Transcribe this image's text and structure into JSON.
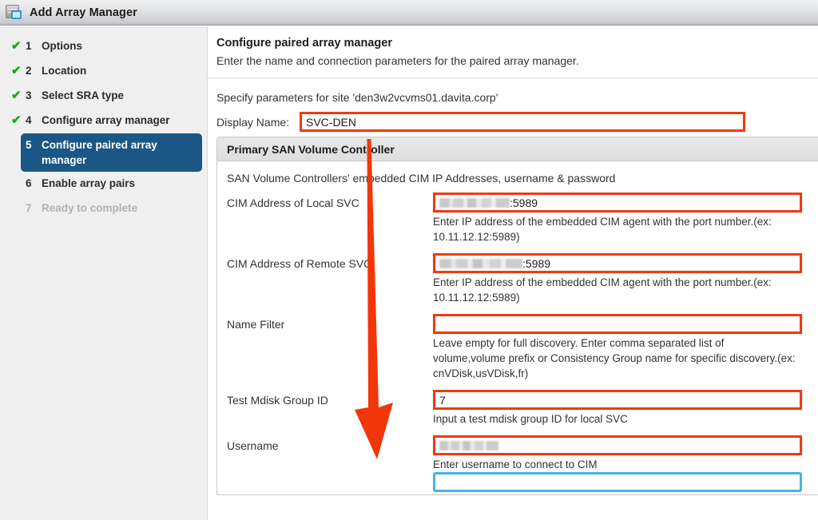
{
  "window": {
    "title": "Add Array Manager",
    "icon": "array-manager-icon"
  },
  "sidebar": {
    "steps": [
      {
        "num": "1",
        "label": "Options",
        "state": "done",
        "check": "✔"
      },
      {
        "num": "2",
        "label": "Location",
        "state": "done",
        "check": "✔"
      },
      {
        "num": "3",
        "label": "Select SRA type",
        "state": "done",
        "check": "✔"
      },
      {
        "num": "4",
        "label": "Configure array manager",
        "state": "done",
        "check": "✔"
      },
      {
        "num": "5",
        "label": "Configure paired array manager",
        "state": "active",
        "check": ""
      },
      {
        "num": "6",
        "label": "Enable array pairs",
        "state": "todo",
        "check": ""
      },
      {
        "num": "7",
        "label": "Ready to complete",
        "state": "disabled",
        "check": ""
      }
    ]
  },
  "page": {
    "title": "Configure paired array manager",
    "subtitle": "Enter the name and connection parameters for the paired array manager.",
    "site_line": "Specify parameters for site 'den3w2vcvms01.davita.corp'",
    "display_name_label": "Display Name:",
    "display_name_value": "SVC-DEN"
  },
  "panel": {
    "header": "Primary SAN Volume Controller",
    "note": "SAN Volume Controllers' embedded CIM IP Addresses, username & password",
    "fields": [
      {
        "label": "CIM Address of Local SVC",
        "value_suffix": ":5989",
        "value_redacted": true,
        "hint": "Enter IP address of the embedded CIM agent with the port number.(ex: 10.11.12.12:5989)"
      },
      {
        "label": "CIM Address of Remote SVC",
        "value_suffix": ":5989",
        "value_redacted": true,
        "hint": "Enter IP address of the embedded CIM agent with the port number.(ex: 10.11.12.12:5989)"
      },
      {
        "label": "Name Filter",
        "value_suffix": "",
        "value_redacted": false,
        "hint": "Leave empty for full discovery. Enter comma separated list of volume,volume prefix or Consistency Group name  for specific discovery.(ex: cnVDisk,usVDisk,fr)"
      },
      {
        "label": "Test Mdisk Group ID",
        "value_suffix": "7",
        "value_redacted": false,
        "hint": "Input a test mdisk group ID for local SVC"
      },
      {
        "label": "Username",
        "value_suffix": "",
        "value_redacted": true,
        "hint": "Enter username to connect to CIM"
      }
    ]
  },
  "annotation": {
    "arrow": "down-arrow-annotation",
    "color": "#f2360a"
  },
  "colors": {
    "accent_active": "#1a5785",
    "check_green": "#16a818",
    "highlight_red": "#ee3b12",
    "focus_blue": "#3fb6e8"
  }
}
